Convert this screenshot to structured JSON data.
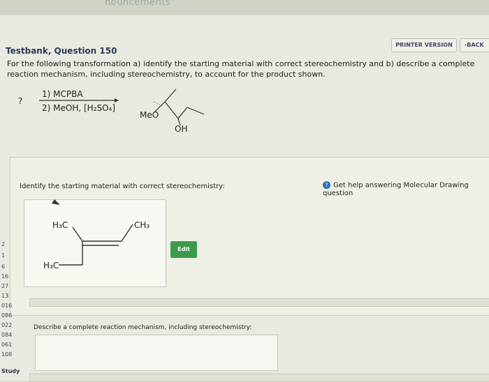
{
  "topbar": {
    "label": "nouncements"
  },
  "buttons": {
    "printer": "PRINTER VERSION",
    "back": "BACK"
  },
  "question": {
    "title": "Testbank, Question 150",
    "text": "For the following transformation a) identify the starting material with correct stereochemistry and b) describe a complete reaction mechanism, including stereochemistry, to account for the product shown.",
    "unknown": "?",
    "reagent1": "1) MCPBA",
    "reagent2": "2) MeOH, [H₂SO₄]",
    "product_labels": {
      "meo": "MeO",
      "oh": "OH"
    }
  },
  "identify": {
    "label": "Identify the starting material with correct stereochemistry:",
    "help": "Get help answering Molecular Drawing question",
    "atoms": {
      "h3c_top": "H₃C",
      "ch3": "CH₃",
      "h3c_bottom": "H₃C"
    },
    "edit": "Edit"
  },
  "mechanism": {
    "label": "Describe a complete reaction mechanism, including stereochemistry:"
  },
  "sidebar": {
    "items": [
      "2",
      "1",
      "6",
      "16",
      "27",
      "13",
      "016",
      "086",
      "022",
      "084",
      "061",
      "108"
    ],
    "study": "Study"
  }
}
